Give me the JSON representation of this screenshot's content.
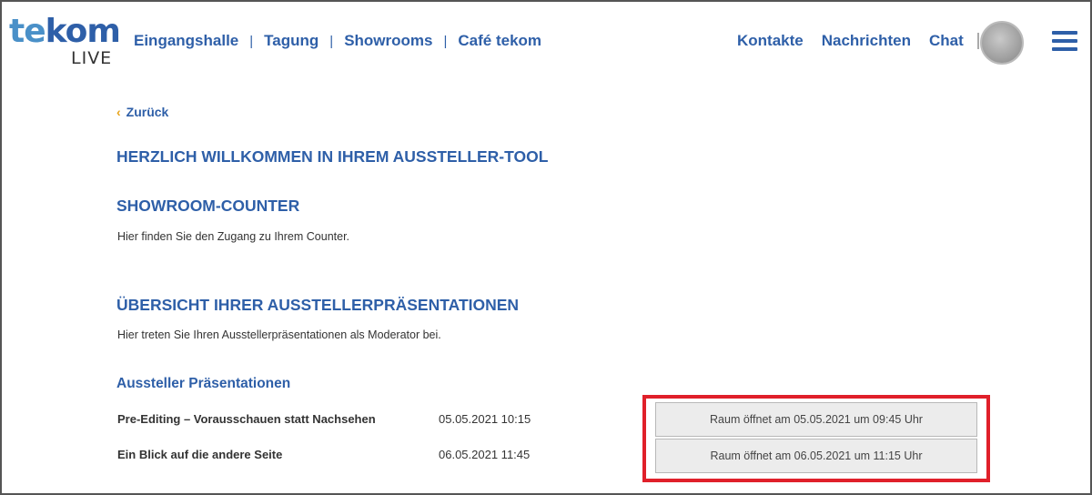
{
  "logo": {
    "main_a": "te",
    "main_b": "kom",
    "sub": "LIVE"
  },
  "nav": {
    "left": [
      "Eingangshalle",
      "Tagung",
      "Showrooms",
      "Café tekom"
    ],
    "separator": "|",
    "right": [
      "Kontakte",
      "Nachrichten",
      "Chat"
    ]
  },
  "icons": {
    "back": "chevron-left-icon",
    "menu": "hamburger-menu-icon",
    "avatar": "user-avatar"
  },
  "colors": {
    "brand_blue": "#2e5fa8",
    "logo_light_blue": "#4a90c8",
    "back_chevron": "#e8a317",
    "highlight_red": "#e0202a"
  },
  "back": {
    "icon": "‹",
    "label": "Zurück"
  },
  "welcome_title": "HERZLICH WILLKOMMEN IN IHREM AUSSTELLER-TOOL",
  "showroom": {
    "title": "SHOWROOM-COUNTER",
    "text": "Hier finden Sie den Zugang zu Ihrem Counter."
  },
  "overview": {
    "title": "ÜBERSICHT IHRER AUSSTELLERPRÄSENTATIONEN",
    "text": "Hier treten Sie Ihren Ausstellerpräsentationen als Moderator bei."
  },
  "presentations": {
    "heading": "Aussteller Präsentationen",
    "rows": [
      {
        "title": "Pre-Editing – Vorausschauen statt Nachsehen",
        "datetime": "05.05.2021 10:15",
        "button": "Raum öffnet am 05.05.2021 um 09:45 Uhr"
      },
      {
        "title": "Ein Blick auf die andere Seite",
        "datetime": "06.05.2021 11:45",
        "button": "Raum öffnet am 06.05.2021 um 11:15 Uhr"
      }
    ]
  }
}
